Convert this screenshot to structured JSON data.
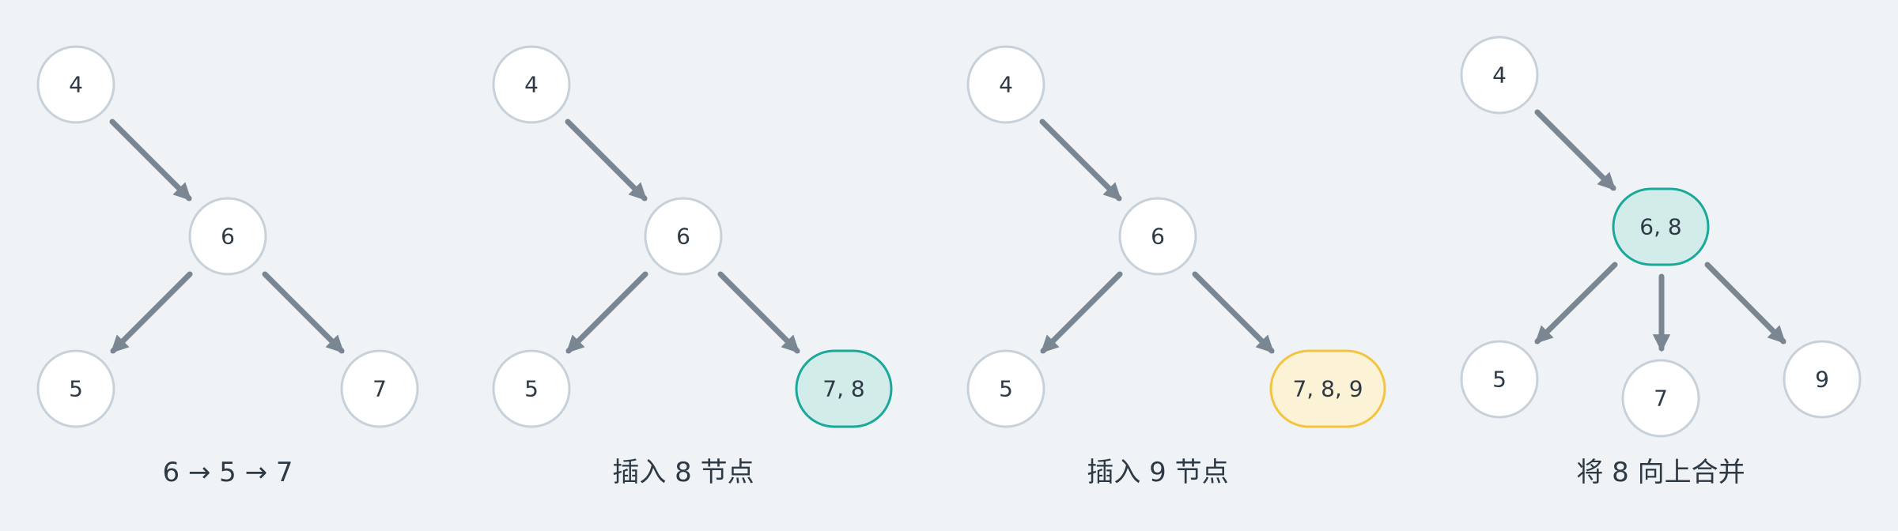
{
  "colors": {
    "background": "#eff3f6",
    "node_fill": "#ffffff",
    "node_stroke": "#c8d1da",
    "edge": "#7a8793",
    "text": "#2d3a45",
    "teal_fill": "#d2ecea",
    "teal_stroke": "#1aa89a",
    "yellow_fill": "#fcf2d6",
    "yellow_stroke": "#f2c43f"
  },
  "panels": [
    {
      "caption": "6 → 5 → 7",
      "nodes": {
        "root": {
          "label": "4",
          "style": "normal"
        },
        "middle": {
          "label": "6",
          "style": "normal"
        },
        "left": {
          "label": "5",
          "style": "normal"
        },
        "right": {
          "label": "7",
          "style": "normal"
        }
      }
    },
    {
      "caption": "插入 8 节点",
      "nodes": {
        "root": {
          "label": "4",
          "style": "normal"
        },
        "middle": {
          "label": "6",
          "style": "normal"
        },
        "left": {
          "label": "5",
          "style": "normal"
        },
        "right": {
          "label": "7, 8",
          "style": "teal"
        }
      }
    },
    {
      "caption": "插入 9 节点",
      "nodes": {
        "root": {
          "label": "4",
          "style": "normal"
        },
        "middle": {
          "label": "6",
          "style": "normal"
        },
        "left": {
          "label": "5",
          "style": "normal"
        },
        "right": {
          "label": "7, 8, 9",
          "style": "yellow"
        }
      }
    },
    {
      "caption": "将 8 向上合并",
      "nodes": {
        "root": {
          "label": "4",
          "style": "normal"
        },
        "middle": {
          "label": "6, 8",
          "style": "teal"
        },
        "left": {
          "label": "5",
          "style": "normal"
        },
        "center": {
          "label": "7",
          "style": "normal"
        },
        "right": {
          "label": "9",
          "style": "normal"
        }
      }
    }
  ]
}
